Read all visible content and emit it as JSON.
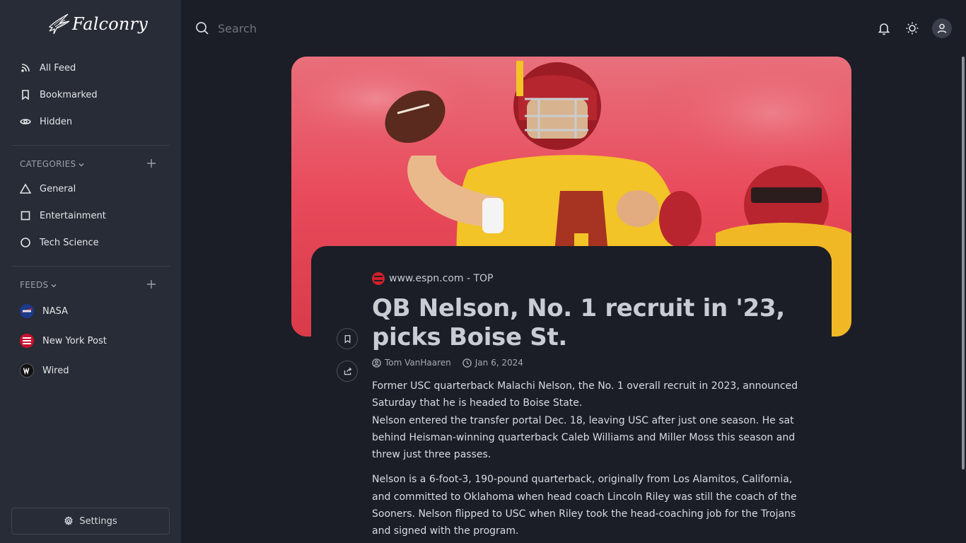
{
  "app": {
    "name": "Falconry"
  },
  "sidebar": {
    "main_items": [
      {
        "label": "All Feed",
        "icon": "rss-icon"
      },
      {
        "label": "Bookmarked",
        "icon": "bookmark-icon"
      },
      {
        "label": "Hidden",
        "icon": "eye-icon"
      }
    ],
    "categories": {
      "heading": "CATEGORIES",
      "items": [
        {
          "label": "General",
          "icon": "triangle-icon"
        },
        {
          "label": "Entertainment",
          "icon": "square-icon"
        },
        {
          "label": "Tech Science",
          "icon": "circle-icon"
        }
      ]
    },
    "feeds": {
      "heading": "FEEDS",
      "items": [
        {
          "label": "NASA",
          "logo_color": "#1d3a8a"
        },
        {
          "label": "New York Post",
          "logo_color": "#c8102e"
        },
        {
          "label": "Wired",
          "logo_color": "#111111"
        }
      ]
    },
    "settings_label": "Settings"
  },
  "search": {
    "placeholder": "Search",
    "value": ""
  },
  "article": {
    "source": "www.espn.com - TOP",
    "title": "QB Nelson, No. 1 recruit in '23, picks Boise St.",
    "author": "Tom VanHaaren",
    "date": "Jan 6, 2024",
    "paragraphs": [
      "Former USC quarterback Malachi Nelson, the No. 1 overall recruit in 2023, announced Saturday that he is headed to Boise State.",
      "Nelson entered the transfer portal Dec. 18, leaving USC after just one season. He sat behind Heisman-winning quarterback Caleb Williams and Miller Moss this season and threw just three passes.",
      "Nelson is a 6-foot-3, 190-pound quarterback, originally from Los Alamitos, California, and committed to Oklahoma when head coach Lincoln Riley was still the coach of the Sooners. Nelson flipped to USC when Riley took the head-coaching job for the Trojans and signed with the program."
    ]
  },
  "colors": {
    "sidebar_bg": "#282c36",
    "main_bg": "#1b1e26",
    "espn_red": "#d1202a"
  }
}
